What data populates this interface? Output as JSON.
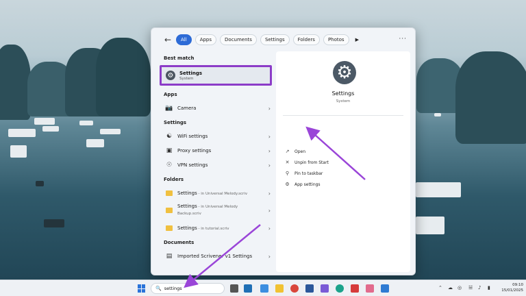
{
  "start_menu": {
    "filters": [
      "All",
      "Apps",
      "Documents",
      "Settings",
      "Folders",
      "Photos"
    ],
    "sections": {
      "best_match": "Best match",
      "apps": "Apps",
      "settings": "Settings",
      "folders": "Folders",
      "documents": "Documents"
    },
    "best_match": {
      "title": "Settings",
      "subtitle": "System"
    },
    "apps": [
      {
        "label": "Camera"
      }
    ],
    "settings_items": [
      {
        "label": "WiFi settings"
      },
      {
        "label": "Proxy settings"
      },
      {
        "label": "VPN settings"
      }
    ],
    "folders": [
      {
        "label": "Settings",
        "sub": " - in Universal Melody.scriv"
      },
      {
        "label": "Settings",
        "sub": " - in Universal Melody",
        "sub2": "Backup.scriv"
      },
      {
        "label": "Settings",
        "sub": " - in tutorial.scriv"
      }
    ],
    "documents": [
      {
        "label": "Imported Scrivener v1 Settings"
      }
    ],
    "preview": {
      "title": "Settings",
      "subtitle": "System",
      "actions": [
        {
          "label": "Open",
          "icon": "open-icon"
        },
        {
          "label": "Unpin from Start",
          "icon": "unpin-icon"
        },
        {
          "label": "Pin to taskbar",
          "icon": "pin-icon"
        },
        {
          "label": "App settings",
          "icon": "gear-icon"
        }
      ]
    }
  },
  "taskbar": {
    "search_value": "settings",
    "time": "09:10",
    "date": "15/01/2025"
  },
  "colors": {
    "accent": "#2d6bd6",
    "highlight": "#8c3cc8"
  }
}
